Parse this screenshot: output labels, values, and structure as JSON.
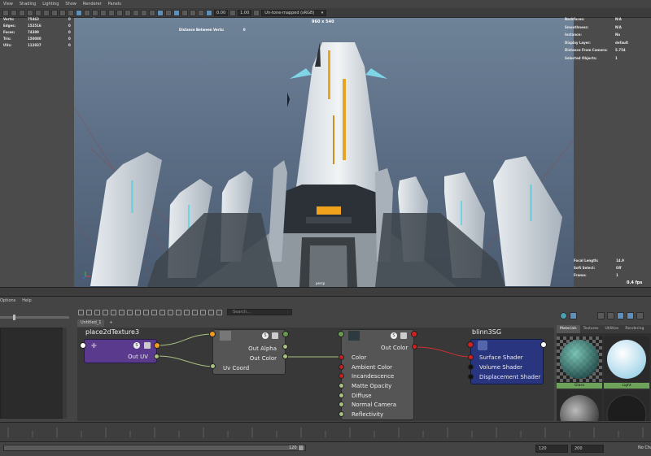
{
  "menu": {
    "items": [
      "View",
      "Shading",
      "Lighting",
      "Show",
      "Renderer",
      "Panels"
    ]
  },
  "toolbar": {
    "exposure_value": "0.00",
    "gamma_value": "1.00",
    "view_transform": "Un-tone-mapped (sRGB)"
  },
  "hud": {
    "left": [
      {
        "label": "Verts:",
        "v1": "75463",
        "v2": "0",
        "v3": "0"
      },
      {
        "label": "Edges:",
        "v1": "152516",
        "v2": "0",
        "v3": "0"
      },
      {
        "label": "Faces:",
        "v1": "74389",
        "v2": "0",
        "v3": "0"
      },
      {
        "label": "Tris:",
        "v1": "150080",
        "v2": "0",
        "v3": "0"
      },
      {
        "label": "UVs:",
        "v1": "112837",
        "v2": "0",
        "v3": "0"
      }
    ],
    "right": [
      {
        "label": "Backfaces:",
        "value": "N/A"
      },
      {
        "label": "Smoothness:",
        "value": "N/A"
      },
      {
        "label": "Instance:",
        "value": "No"
      },
      {
        "label": "Display Layer:",
        "value": "default"
      },
      {
        "label": "Distance From Camera:",
        "value": "5.754"
      },
      {
        "label": "Selected Objects:",
        "value": "1"
      }
    ],
    "right_bottom": [
      {
        "label": "Focal Length:",
        "value": "14.9"
      },
      {
        "label": "Soft Select:",
        "value": "Off"
      },
      {
        "label": "Frame:",
        "value": "1"
      }
    ],
    "resolution": "960 x 540",
    "distance_between_verts_label": "Distance Between Verts:",
    "distance_between_verts_value": "0",
    "camera_name": "persp",
    "fps": "0.4 fps"
  },
  "lower_left": {
    "menu": [
      "Options",
      "Help"
    ]
  },
  "node_editor": {
    "search_placeholder": "Search...",
    "tabs": [
      "Untitled_1"
    ],
    "add_tab": "+",
    "nodes": {
      "place2d": {
        "title": "place2dTexture3",
        "ports": [
          "Out UV"
        ],
        "badge": "S"
      },
      "file": {
        "badge": "S",
        "ports_out": [
          "Out Alpha",
          "Out Color"
        ],
        "ports_in": [
          "Uv Coord"
        ]
      },
      "blinn": {
        "badge": "S",
        "out": "Out Color",
        "ports_in": [
          "Color",
          "Ambient Color",
          "Incandescence",
          "Matte Opacity",
          "Diffuse",
          "Normal Camera",
          "Reflectivity"
        ]
      },
      "sg": {
        "title": "blinn3SG",
        "ports_in": [
          "Surface Shader",
          "Volume Shader",
          "Displacement Shader"
        ]
      }
    }
  },
  "material_browser": {
    "tabs": [
      "Materials",
      "Textures",
      "Utilities",
      "Rendering"
    ],
    "swatches": [
      "Glass",
      "Light"
    ]
  },
  "timeline": {
    "range_end": "120",
    "start_value": "120",
    "end_value": "200",
    "character_set": "No Character Set"
  }
}
